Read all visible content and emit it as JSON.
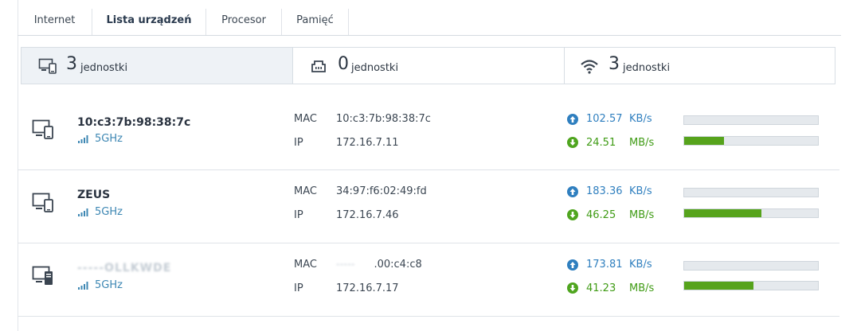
{
  "tabs": [
    {
      "label": "Internet",
      "active": false
    },
    {
      "label": "Lista urządzeń",
      "active": true
    },
    {
      "label": "Procesor",
      "active": false
    },
    {
      "label": "Pamięć",
      "active": false
    }
  ],
  "summary": {
    "wired": {
      "count": "3",
      "unit": "jednostki",
      "icon": "devices-icon"
    },
    "ethernet": {
      "count": "0",
      "unit": "jednostki",
      "icon": "ethernet-port-icon"
    },
    "wifi": {
      "count": "3",
      "unit": "jednostki",
      "icon": "wifi-icon"
    }
  },
  "labels": {
    "mac": "MAC",
    "ip": "IP"
  },
  "devices": [
    {
      "name": "10:c3:7b:98:38:7c",
      "band": "5GHz",
      "mac": "10:c3:7b:98:38:7c",
      "ip": "172.16.7.11",
      "up_rate": "102.57",
      "up_unit": "KB/s",
      "up_level": 0.0,
      "down_rate": "24.51",
      "down_unit": "MB/s",
      "down_level": 0.3
    },
    {
      "name": "ZEUS",
      "band": "5GHz",
      "mac": "34:97:f6:02:49:fd",
      "ip": "172.16.7.46",
      "up_rate": "183.36",
      "up_unit": "KB/s",
      "up_level": 0.0,
      "down_rate": "46.25",
      "down_unit": "MB/s",
      "down_level": 0.58
    },
    {
      "name": "-----OLLKWDE",
      "band": "5GHz",
      "mac_obscured": "-----",
      "mac": ".00:c4:c8",
      "ip": "172.16.7.17",
      "up_rate": "173.81",
      "up_unit": "KB/s",
      "up_level": 0.0,
      "down_rate": "41.23",
      "down_unit": "MB/s",
      "down_level": 0.52
    }
  ],
  "colors": {
    "accent_blue": "#2f7fbf",
    "accent_green": "#56a31c",
    "band_blue": "#3d87b3"
  }
}
